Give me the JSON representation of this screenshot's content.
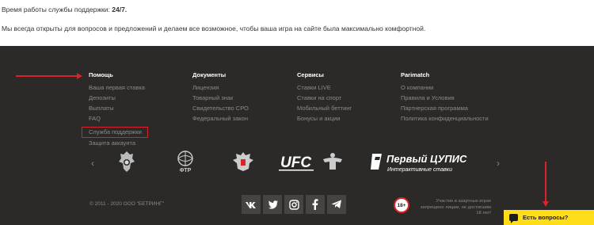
{
  "intro": {
    "hours_label": "Время работы службы поддержки:",
    "hours_value": "24/7.",
    "text": "Мы всегда открыты для вопросов и предложений и делаем все возможное, чтобы ваша игра на сайте была максимально комфортной."
  },
  "footer": {
    "columns": [
      {
        "title": "Помощь",
        "items": [
          "Ваша первая ставка",
          "Депозиты",
          "Выплаты",
          "FAQ",
          "Служба поддержки",
          "Защита аккаунта"
        ]
      },
      {
        "title": "Документы",
        "items": [
          "Лицензия",
          "Товарный знак",
          "Свидетельство СРО",
          "Федеральный закон"
        ]
      },
      {
        "title": "Сервисы",
        "items": [
          "Ставки LIVE",
          "Ставки на спорт",
          "Мобильный беттинг",
          "Бонусы и акции"
        ]
      },
      {
        "title": "Parimatch",
        "items": [
          "О компании",
          "Правила и Условия",
          "Партнерская программа",
          "Политика конфиденциальности"
        ]
      }
    ],
    "partners": {
      "ftr_label": "ФТР",
      "ufc_label": "UFC",
      "cupis_name": "Первый ЦУПИС",
      "cupis_sub": "Интерактивные ставки"
    },
    "copyright": "© 2011 - 2020 ООО \"БЕТРИНГ\"",
    "socials": [
      "vk-icon",
      "twitter-icon",
      "instagram-icon",
      "facebook-icon",
      "telegram-icon"
    ],
    "age_badge": "18+",
    "age_notice": "Участие в азартных играх запрещено лицам, не достигшим 18 лет!",
    "chat_label": "Есть вопросы?"
  },
  "colors": {
    "footer_bg": "#2b2a28",
    "highlight_red": "#d9232a",
    "chat_yellow": "#ffdd1a"
  }
}
